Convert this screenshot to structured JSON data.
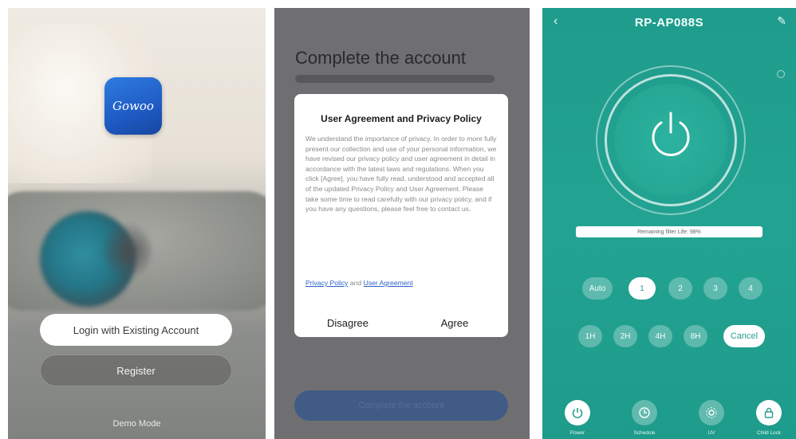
{
  "screen1": {
    "app_icon_text": "Gowoo",
    "login_button": "Login with Existing Account",
    "register_button": "Register",
    "footer_link": "Demo Mode"
  },
  "screen2": {
    "title": "Complete the account",
    "dialog": {
      "title": "User Agreement and Privacy Policy",
      "body": "We understand the importance of privacy. In order to more fully present our collection and use of your personal information, we have revised our privacy policy and user agreement in detail in accordance with the latest laws and regulations. When you click [Agree], you have fully read, understood and accepted all of the updated Privacy Policy and User Agreement. Please take some time to read carefully with our privacy policy, and if you have any questions, please feel free to contact us.",
      "privacy_link": "Privacy Policy",
      "and_text": " and ",
      "agreement_link": "User Agreement",
      "disagree_button": "Disagree",
      "agree_button": "Agree"
    },
    "bottom_button": "Complete the account"
  },
  "screen3": {
    "title": "RP-AP088S",
    "status_text": "Remaining filter Life: 98%",
    "speed_options": [
      "Auto",
      "1",
      "2",
      "3",
      "4"
    ],
    "speed_selected": "1",
    "timer_options": [
      "1H",
      "2H",
      "4H",
      "8H"
    ],
    "cancel_button": "Cancel",
    "nav": [
      {
        "label": "Power",
        "icon": "power-icon"
      },
      {
        "label": "Schedule",
        "icon": "clock-icon"
      },
      {
        "label": "UV",
        "icon": "uv-icon"
      },
      {
        "label": "Child Lock",
        "icon": "lock-icon"
      }
    ],
    "colors": {
      "background": "#22a392",
      "accent": "#ffffff"
    }
  }
}
